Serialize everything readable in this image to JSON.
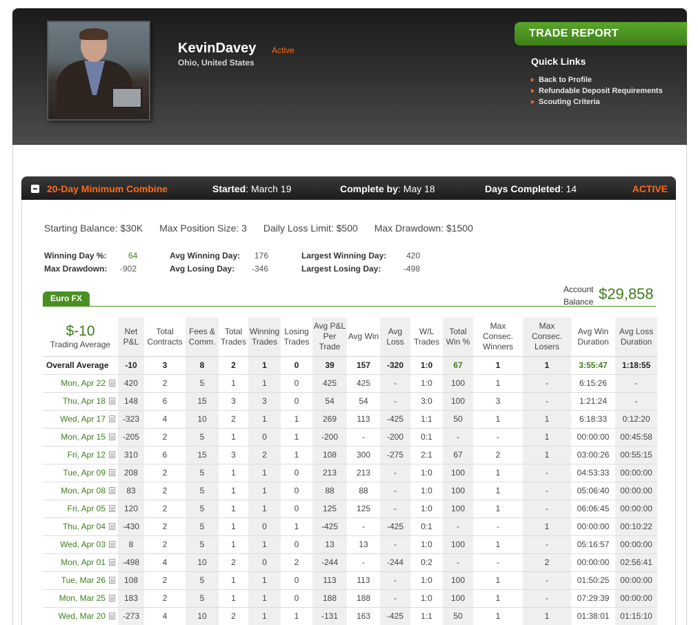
{
  "header": {
    "user_name": "KevinDavey",
    "status": "Active",
    "location": "Ohio, United States",
    "trade_report_label": "TRADE REPORT",
    "quick_links_title": "Quick Links",
    "quick_links": [
      "Back to Profile",
      "Refundable Deposit Requirements",
      "Scouting Criteria"
    ]
  },
  "combine": {
    "title": "20-Day Minimum Combine",
    "started_label": "Started",
    "started_value": ": March 19",
    "complete_label": "Complete by",
    "complete_value": ": May 18",
    "days_label": "Days Completed",
    "days_value": ": 14",
    "status": "ACTIVE"
  },
  "rules": {
    "starting_balance": "Starting Balance: $30K",
    "max_position": "Max Position Size: 3",
    "daily_loss": "Daily Loss Limit: $500",
    "max_drawdown": "Max Drawdown: $1500"
  },
  "stats": {
    "winning_day_pct_label": "Winning Day %:",
    "winning_day_pct": "64",
    "max_drawdown_label": "Max Drawdown:",
    "max_drawdown": "-902",
    "avg_winning_day_label": "Avg Winning Day:",
    "avg_winning_day": "176",
    "avg_losing_day_label": "Avg Losing Day:",
    "avg_losing_day": "-346",
    "largest_winning_day_label": "Largest Winning Day:",
    "largest_winning_day": "420",
    "largest_losing_day_label": "Largest Losing Day:",
    "largest_losing_day": "-498"
  },
  "product_tab": "Euro FX",
  "account": {
    "label_line1": "Account",
    "label_line2": "Balance",
    "value": "$29,858"
  },
  "table": {
    "summary_value": "$-10",
    "summary_label": "Trading Average",
    "headers": [
      "Net P&L",
      "Total Contracts",
      "Fees & Comm.",
      "Total Trades",
      "Winning Trades",
      "Losing Trades",
      "Avg P&L Per Trade",
      "Avg Win",
      "Avg Loss",
      "W/L Trades",
      "Total Win %",
      "Max Consec. Winners",
      "Max Consec. Losers",
      "Avg Win Duration",
      "Avg Loss Duration"
    ],
    "average_row": [
      "Overall Average",
      "-10",
      "3",
      "8",
      "2",
      "1",
      "0",
      "39",
      "157",
      "-320",
      "1:0",
      "67",
      "1",
      "1",
      "3:55:47",
      "1:18:55"
    ],
    "rows": [
      [
        "Mon, Apr 22",
        "420",
        "2",
        "5",
        "1",
        "1",
        "0",
        "425",
        "425",
        "-",
        "1:0",
        "100",
        "1",
        "-",
        "6:15:26",
        "-"
      ],
      [
        "Thu, Apr 18",
        "148",
        "6",
        "15",
        "3",
        "3",
        "0",
        "54",
        "54",
        "-",
        "3:0",
        "100",
        "3",
        "-",
        "1:21:24",
        "-"
      ],
      [
        "Wed, Apr 17",
        "-323",
        "4",
        "10",
        "2",
        "1",
        "1",
        "269",
        "113",
        "-425",
        "1:1",
        "50",
        "1",
        "1",
        "6:18:33",
        "0:12:20"
      ],
      [
        "Mon, Apr 15",
        "-205",
        "2",
        "5",
        "1",
        "0",
        "1",
        "-200",
        "-",
        "-200",
        "0:1",
        "-",
        "-",
        "1",
        "00:00:00",
        "00:45:58"
      ],
      [
        "Fri, Apr 12",
        "310",
        "6",
        "15",
        "3",
        "2",
        "1",
        "108",
        "300",
        "-275",
        "2:1",
        "67",
        "2",
        "1",
        "03:00:26",
        "00:55:15"
      ],
      [
        "Tue, Apr 09",
        "208",
        "2",
        "5",
        "1",
        "1",
        "0",
        "213",
        "213",
        "-",
        "1:0",
        "100",
        "1",
        "-",
        "04:53:33",
        "00:00:00"
      ],
      [
        "Mon, Apr 08",
        "83",
        "2",
        "5",
        "1",
        "1",
        "0",
        "88",
        "88",
        "-",
        "1:0",
        "100",
        "1",
        "-",
        "05:06:40",
        "00:00:00"
      ],
      [
        "Fri, Apr 05",
        "120",
        "2",
        "5",
        "1",
        "1",
        "0",
        "125",
        "125",
        "-",
        "1:0",
        "100",
        "1",
        "-",
        "06:06:45",
        "00:00:00"
      ],
      [
        "Thu, Apr 04",
        "-430",
        "2",
        "5",
        "1",
        "0",
        "1",
        "-425",
        "-",
        "-425",
        "0:1",
        "-",
        "-",
        "1",
        "00:00:00",
        "00:10:22"
      ],
      [
        "Wed, Apr 03",
        "8",
        "2",
        "5",
        "1",
        "1",
        "0",
        "13",
        "13",
        "-",
        "1:0",
        "100",
        "1",
        "-",
        "05:16:57",
        "00:00:00"
      ],
      [
        "Mon, Apr 01",
        "-498",
        "4",
        "10",
        "2",
        "0",
        "2",
        "-244",
        "-",
        "-244",
        "0:2",
        "-",
        "-",
        "2",
        "00:00:00",
        "02:56:41"
      ],
      [
        "Tue, Mar 26",
        "108",
        "2",
        "5",
        "1",
        "1",
        "0",
        "113",
        "113",
        "-",
        "1:0",
        "100",
        "1",
        "-",
        "01:50:25",
        "00:00:00"
      ],
      [
        "Mon, Mar 25",
        "183",
        "2",
        "5",
        "1",
        "1",
        "0",
        "188",
        "188",
        "-",
        "1:0",
        "100",
        "1",
        "-",
        "07:29:39",
        "00:00:00"
      ],
      [
        "Wed, Mar 20",
        "-273",
        "4",
        "10",
        "2",
        "1",
        "1",
        "-131",
        "163",
        "-425",
        "1:1",
        "50",
        "1",
        "1",
        "01:38:01",
        "01:15:10"
      ]
    ]
  },
  "colors": {
    "accent_orange": "#ff6a1a",
    "accent_green": "#3d7d1a",
    "tab_green": "#4a8f22"
  }
}
